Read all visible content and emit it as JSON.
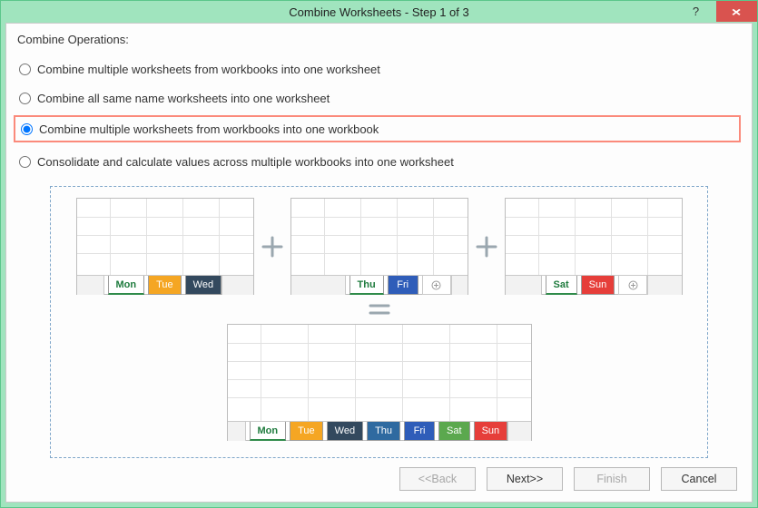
{
  "window": {
    "title": "Combine Worksheets - Step 1 of 3",
    "help_symbol": "?",
    "close_symbol": "×"
  },
  "group": {
    "legend": "Combine Operations:",
    "options": [
      {
        "id": "opt1",
        "label": "Combine multiple worksheets from workbooks into one worksheet",
        "selected": false
      },
      {
        "id": "opt2",
        "label": "Combine all same name worksheets into one worksheet",
        "selected": false
      },
      {
        "id": "opt3",
        "label": "Combine multiple worksheets from workbooks into one workbook",
        "selected": true
      },
      {
        "id": "opt4",
        "label": "Consolidate and calculate values across multiple workbooks into one worksheet",
        "selected": false
      }
    ]
  },
  "preview": {
    "workbooks": [
      {
        "tabs": [
          {
            "label": "Mon",
            "style": "active"
          },
          {
            "label": "Tue",
            "style": "orange"
          },
          {
            "label": "Wed",
            "style": "navy"
          }
        ]
      },
      {
        "tabs": [
          {
            "label": "Thu",
            "style": "active"
          },
          {
            "label": "Fri",
            "style": "royal"
          }
        ],
        "plus": true
      },
      {
        "tabs": [
          {
            "label": "Sat",
            "style": "active"
          },
          {
            "label": "Sun",
            "style": "red"
          }
        ],
        "plus": true
      }
    ],
    "result": {
      "tabs": [
        {
          "label": "Mon",
          "style": "active"
        },
        {
          "label": "Tue",
          "style": "orange"
        },
        {
          "label": "Wed",
          "style": "navy"
        },
        {
          "label": "Thu",
          "style": "blue"
        },
        {
          "label": "Fri",
          "style": "royal"
        },
        {
          "label": "Sat",
          "style": "green"
        },
        {
          "label": "Sun",
          "style": "red"
        }
      ]
    }
  },
  "footer": {
    "back": "<<Back",
    "next": "Next>>",
    "finish": "Finish",
    "cancel": "Cancel"
  }
}
